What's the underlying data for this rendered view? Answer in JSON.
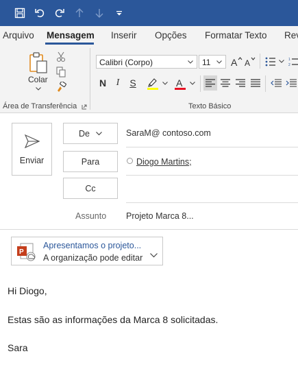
{
  "tabs": [
    "Arquivo",
    "Mensagem",
    "Inserir",
    "Opções",
    "Formatar Texto",
    "Rev"
  ],
  "clipboard": {
    "paste_label": "Colar",
    "group_label": "Área de Transferência"
  },
  "basic_text": {
    "font_name": "Calibri (Corpo)",
    "font_size": "11",
    "bold": "N",
    "italic": "I",
    "underline": "S",
    "group_label": "Texto Básico"
  },
  "compose": {
    "send_label": "Enviar",
    "from_label": "De",
    "from_value": "SaraM@ contoso.com",
    "to_label": "Para",
    "to_value": "Diogo Martins;",
    "cc_label": "Cc",
    "subject_label": "Assunto",
    "subject_value": "Projeto Marca 8...",
    "attachment_name": "Apresentamos o projeto...",
    "attachment_permission": "A organização pode editar"
  },
  "body": {
    "greeting": "Hi Diogo,",
    "line1": "Estas são as informações da Marca 8 solicitadas.",
    "signature": "Sara"
  },
  "colors": {
    "title_bar": "#2b579a",
    "highlight": "#ffff00",
    "font_color": "#e81123",
    "ppt": "#c43e1c"
  }
}
